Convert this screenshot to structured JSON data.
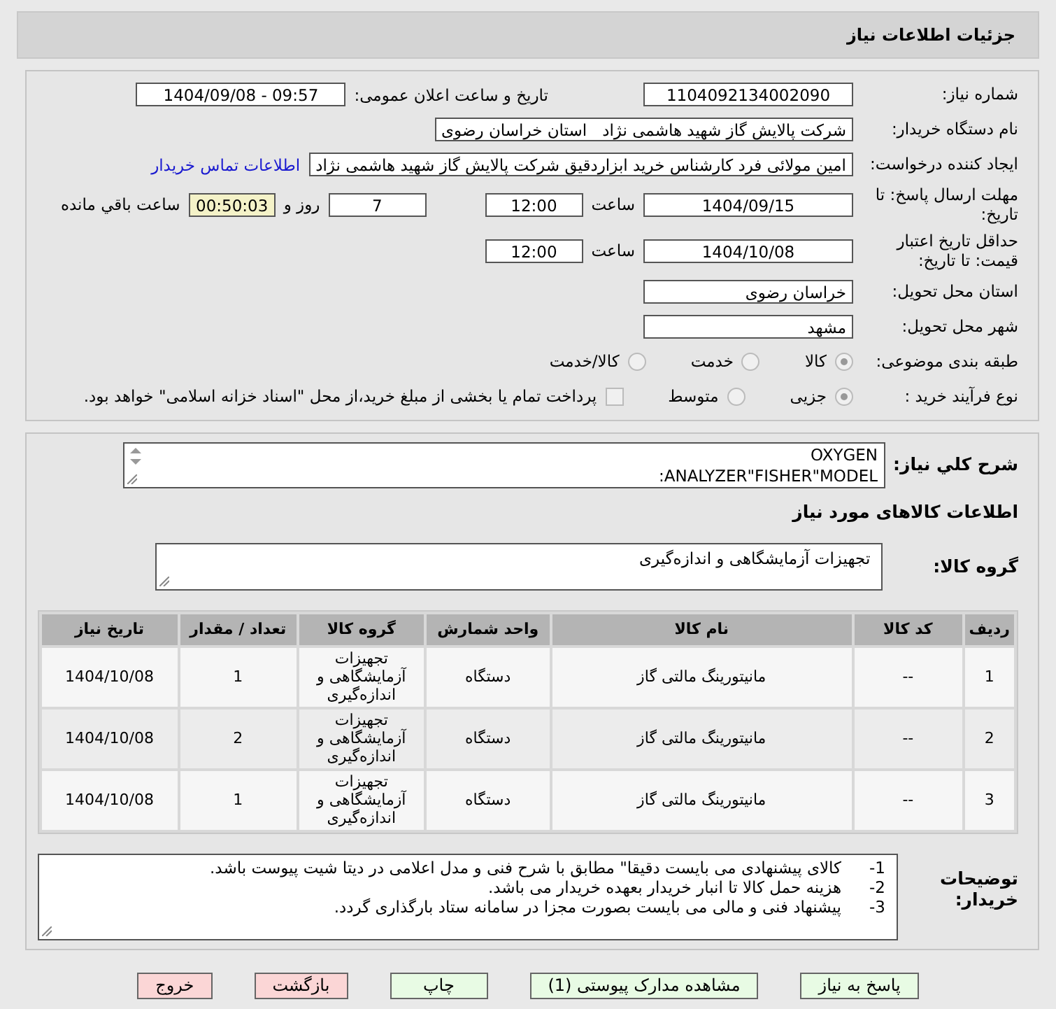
{
  "header": {
    "title": "جزئیات اطلاعات نیاز"
  },
  "details": {
    "need_number": {
      "label": "شماره نیاز:",
      "value": "1104092134002090"
    },
    "announce": {
      "label": "تاریخ و ساعت اعلان عمومی:",
      "value": "1404/09/08 - 09:57"
    },
    "buyer": {
      "label": "نام دستگاه خریدار:",
      "value": "شرکت پالایش گاز شهید هاشمی نژاد   استان خراسان رضوی"
    },
    "creator": {
      "label": "ایجاد کننده درخواست:",
      "value": "امین مولائی فرد کارشناس خرید ابزاردقیق شرکت پالایش گاز شهید هاشمی نژاد",
      "link": "اطلاعات تماس خریدار"
    },
    "deadline": {
      "label": "مهلت ارسال پاسخ: تا تاریخ:",
      "date": "1404/09/15",
      "time_label": "ساعت",
      "time": "12:00",
      "days": "7",
      "days_label": "روز و",
      "remaining": "00:50:03",
      "remaining_label": "ساعت باقي مانده"
    },
    "validity": {
      "label": "حداقل تاریخ اعتبار قیمت: تا تاریخ:",
      "date": "1404/10/08",
      "time_label": "ساعت",
      "time": "12:00"
    },
    "province": {
      "label": "استان محل تحویل:",
      "value": "خراسان رضوی"
    },
    "city": {
      "label": "شهر محل تحویل:",
      "value": "مشهد"
    },
    "category": {
      "label": "طبقه بندی موضوعی:",
      "options": [
        {
          "label": "کالا",
          "selected": true
        },
        {
          "label": "خدمت",
          "selected": false
        },
        {
          "label": "کالا/خدمت",
          "selected": false
        }
      ]
    },
    "process": {
      "label": "نوع فرآیند خرید :",
      "options": [
        {
          "label": "جزیی",
          "selected": true
        },
        {
          "label": "متوسط",
          "selected": false
        }
      ],
      "payment": {
        "checked": false,
        "label": "پرداخت تمام یا بخشی از مبلغ خرید،از محل \"اسناد خزانه اسلامی\" خواهد بود."
      }
    }
  },
  "need": {
    "description": {
      "label": "شرح کلي نياز:",
      "lines": [
        "OXYGEN",
        "ANALYZER\"FISHER\"MODEL:"
      ]
    },
    "items_title": "اطلاعات کالاهای مورد نیاز",
    "goods_group": {
      "label": "گروه کالا:",
      "value": "تجهیزات آزمایشگاهی و اندازه‌گیری"
    },
    "table": {
      "columns": [
        "ردیف",
        "کد کالا",
        "نام کالا",
        "واحد شمارش",
        "گروه کالا",
        "تعداد / مقدار",
        "تاریخ نیاز"
      ],
      "rows": [
        [
          "1",
          "--",
          "مانیتورینگ مالتی گاز",
          "دستگاه",
          "تجهیزات آزمایشگاهی و اندازه‌گیری",
          "1",
          "1404/10/08"
        ],
        [
          "2",
          "--",
          "مانیتورینگ مالتی گاز",
          "دستگاه",
          "تجهیزات آزمایشگاهی و اندازه‌گیری",
          "2",
          "1404/10/08"
        ],
        [
          "3",
          "--",
          "مانیتورینگ مالتی گاز",
          "دستگاه",
          "تجهیزات آزمایشگاهی و اندازه‌گیری",
          "1",
          "1404/10/08"
        ]
      ]
    },
    "notes": {
      "label": "توضیحات خریدار:",
      "lines": [
        {
          "num": "1-",
          "text": "کالای پیشنهادی می بایست دقیقا\" مطابق با شرح فنی و مدل اعلامی در دیتا شیت پیوست باشد."
        },
        {
          "num": "2-",
          "text": "هزینه حمل کالا تا انبار خریدار بعهده خریدار می باشد."
        },
        {
          "num": "3-",
          "text": "پیشنهاد فنی و مالی می بایست بصورت مجزا در سامانه ستاد بارگذاری گردد."
        }
      ]
    }
  },
  "buttons": [
    {
      "label": "پاسخ به نیاز",
      "kind": "normal"
    },
    {
      "label": "مشاهده مدارک پیوستی (1)",
      "kind": "normal"
    },
    {
      "label": "چاپ",
      "kind": "normal"
    },
    {
      "label": "بازگشت",
      "kind": "danger"
    },
    {
      "label": "خروج",
      "kind": "danger"
    }
  ]
}
